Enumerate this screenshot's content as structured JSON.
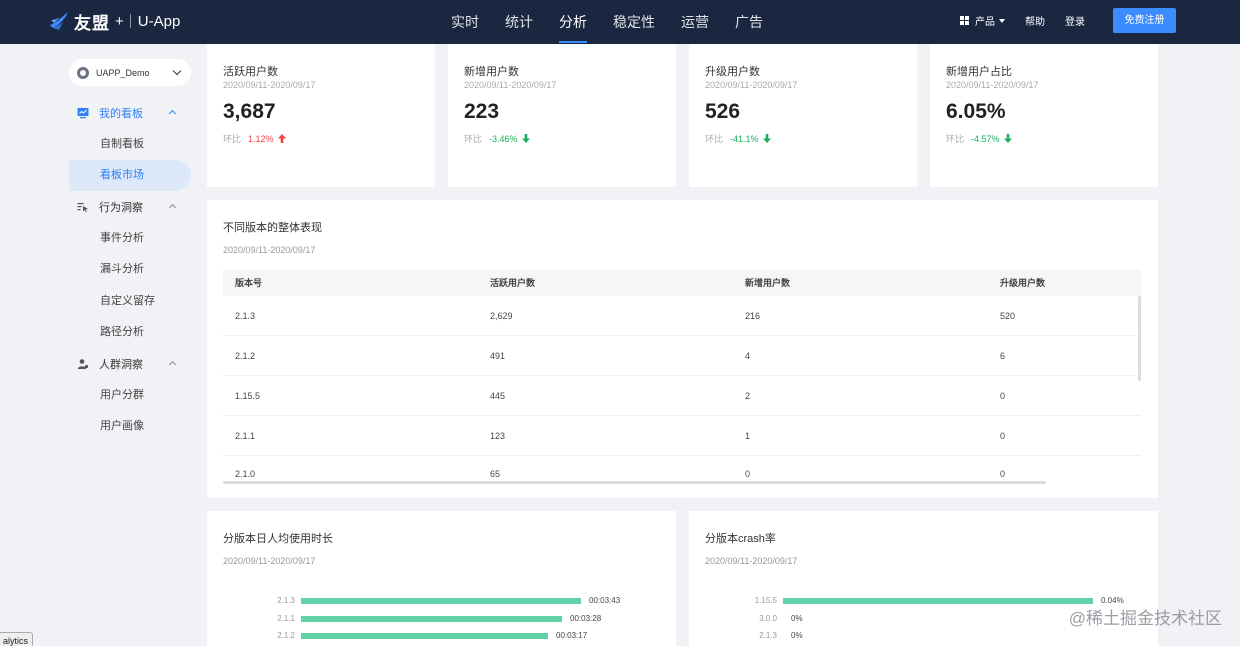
{
  "header": {
    "brand": "友盟",
    "plus": "+",
    "app": "U-App",
    "nav": [
      {
        "label": "实时"
      },
      {
        "label": "统计"
      },
      {
        "label": "分析"
      },
      {
        "label": "稳定性"
      },
      {
        "label": "运营"
      },
      {
        "label": "广告"
      }
    ],
    "active_nav": "分析",
    "products_label": "产品",
    "help_label": "帮助",
    "login_label": "登录",
    "signup_label": "免费注册"
  },
  "sidebar": {
    "app_select": "UAPP_Demo",
    "groups": [
      {
        "label": "我的看板",
        "items": [
          "自制看板",
          "看板市场"
        ]
      },
      {
        "label": "行为洞察",
        "items": [
          "事件分析",
          "漏斗分析",
          "自定义留存",
          "路径分析"
        ]
      },
      {
        "label": "人群洞察",
        "items": [
          "用户分群",
          "用户画像"
        ]
      }
    ],
    "active_item": "看板市场"
  },
  "kpis": [
    {
      "title": "活跃用户数",
      "date": "2020/09/11-2020/09/17",
      "value": "3,687",
      "cmp_label": "环比",
      "pct": "1.12%",
      "trend": "up"
    },
    {
      "title": "新增用户数",
      "date": "2020/09/11-2020/09/17",
      "value": "223",
      "cmp_label": "环比",
      "pct": "-3.46%",
      "trend": "down"
    },
    {
      "title": "升级用户数",
      "date": "2020/09/11-2020/09/17",
      "value": "526",
      "cmp_label": "环比",
      "pct": "-41.1%",
      "trend": "down"
    },
    {
      "title": "新增用户占比",
      "date": "2020/09/11-2020/09/17",
      "value": "6.05%",
      "cmp_label": "环比",
      "pct": "-4.57%",
      "trend": "down"
    }
  ],
  "versions_table": {
    "title": "不同版本的整体表现",
    "date": "2020/09/11-2020/09/17",
    "columns": [
      "版本号",
      "活跃用户数",
      "新增用户数",
      "升级用户数"
    ],
    "rows": [
      [
        "2.1.3",
        "2,629",
        "216",
        "520"
      ],
      [
        "2.1.2",
        "491",
        "4",
        "6"
      ],
      [
        "1.15.5",
        "445",
        "2",
        "0"
      ],
      [
        "2.1.1",
        "123",
        "1",
        "0"
      ],
      [
        "2.1.0",
        "65",
        "0",
        "0"
      ]
    ]
  },
  "duration_panel": {
    "title": "分版本日人均使用时长",
    "date": "2020/09/11-2020/09/17"
  },
  "crash_panel": {
    "title": "分版本crash率",
    "date": "2020/09/11-2020/09/17"
  },
  "chart_data": [
    {
      "type": "bar",
      "orientation": "horizontal",
      "categories": [
        "2.1.3",
        "2.1.1",
        "2.1.2"
      ],
      "values": [
        223,
        208,
        197
      ],
      "value_labels": [
        "00:03:43",
        "00:03:28",
        "00:03:17"
      ],
      "unit": "seconds",
      "color": "#5fd2a8",
      "grid": false,
      "legend": "none"
    },
    {
      "type": "bar",
      "orientation": "horizontal",
      "categories": [
        "1.15.5",
        "3.0.0",
        "2.1.3"
      ],
      "values": [
        0.04,
        0,
        0
      ],
      "value_labels": [
        "0.04%",
        "0%",
        "0%"
      ],
      "unit": "percent",
      "color": "#5fd2a8",
      "grid": false,
      "legend": "none"
    }
  ],
  "overlay": {
    "watermark": "@稀土掘金技术社区",
    "tooltip": "alytics"
  },
  "colors": {
    "nav_bg": "#1b2740",
    "accent": "#3b8cff",
    "up": "#f0443f",
    "down": "#18b05a",
    "bar": "#5fd2a8"
  }
}
